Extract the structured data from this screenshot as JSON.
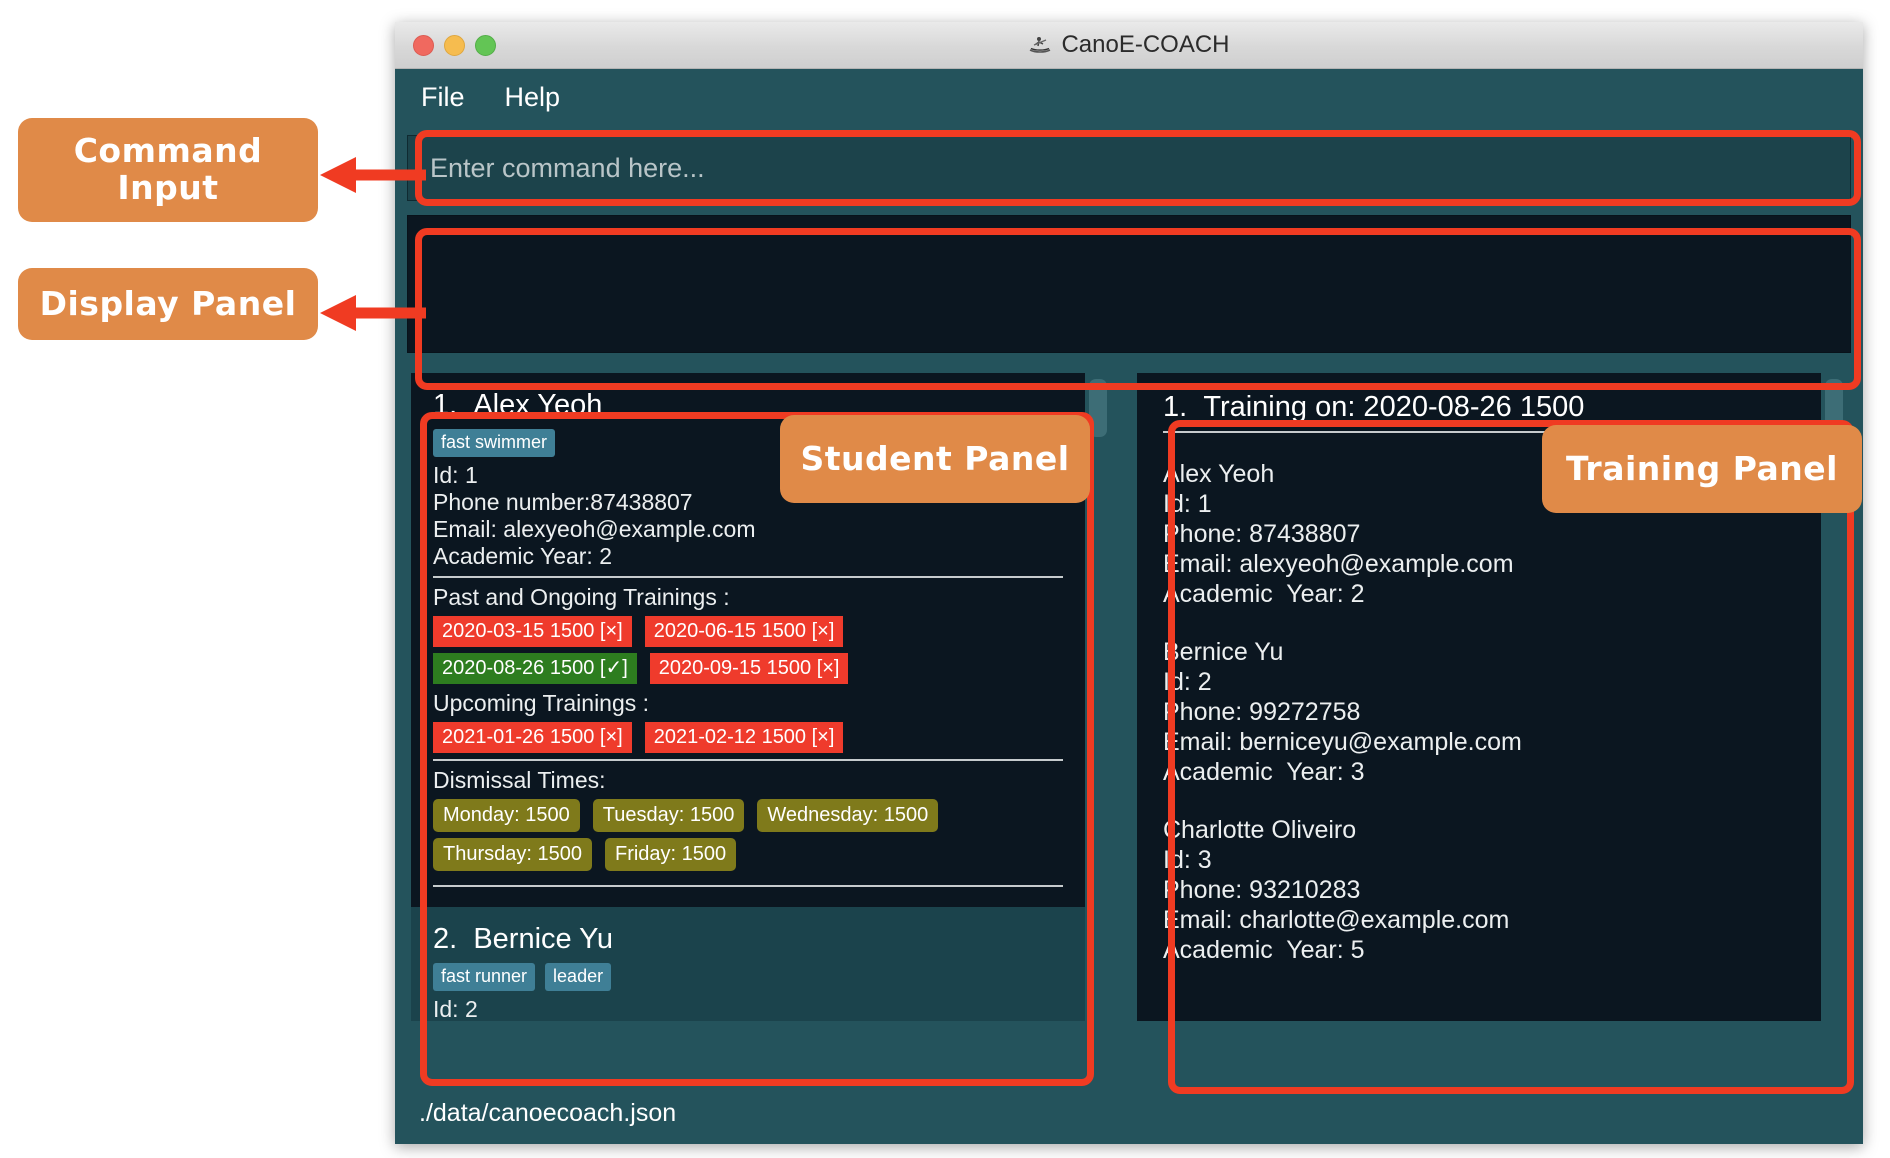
{
  "window": {
    "title": "CanoE-COACH",
    "icon": "canoe-icon",
    "traffic_lights": [
      "close-button",
      "minimize-button",
      "maximize-button"
    ]
  },
  "menubar": {
    "items": [
      {
        "label": "File"
      },
      {
        "label": "Help"
      }
    ]
  },
  "command_input": {
    "placeholder": "Enter command here...",
    "value": ""
  },
  "display_panel": {
    "content": ""
  },
  "student_panel": {
    "students": [
      {
        "index": "1.",
        "name": "Alex Yeoh",
        "tags": [
          "fast swimmer"
        ],
        "id": "Id: 1",
        "phone": "Phone number:87438807",
        "email": "Email: alexyeoh@example.com",
        "academic_year": "Academic Year: 2",
        "past_label": "Past and Ongoing Trainings :",
        "past_trainings": [
          {
            "text": "2020-03-15 1500 [×]",
            "status": "absent"
          },
          {
            "text": "2020-06-15 1500 [×]",
            "status": "absent"
          },
          {
            "text": "2020-08-26 1500 [✓]",
            "status": "attended"
          },
          {
            "text": "2020-09-15 1500 [×]",
            "status": "absent"
          }
        ],
        "upcoming_label": "Upcoming Trainings :",
        "upcoming_trainings": [
          {
            "text": "2021-01-26 1500 [×]",
            "status": "absent"
          },
          {
            "text": "2021-02-12 1500 [×]",
            "status": "absent"
          }
        ],
        "dismissal_label": "Dismissal Times:",
        "dismissal_times": [
          "Monday: 1500",
          "Tuesday: 1500",
          "Wednesday: 1500",
          "Thursday: 1500",
          "Friday: 1500"
        ]
      },
      {
        "index": "2.",
        "name": "Bernice Yu",
        "tags": [
          "fast runner",
          "leader"
        ],
        "id": "Id: 2"
      }
    ]
  },
  "training_panel": {
    "training": {
      "index": "1.",
      "title": "Training on: 2020-08-26 1500",
      "attendees": [
        {
          "name": "Alex Yeoh",
          "id": "Id: 1",
          "phone": "Phone: 87438807",
          "email": "Email: alexyeoh@example.com",
          "academic_year": "Academic  Year: 2"
        },
        {
          "name": "Bernice Yu",
          "id": "Id: 2",
          "phone": "Phone: 99272758",
          "email": "Email: berniceyu@example.com",
          "academic_year": "Academic  Year: 3"
        },
        {
          "name": "Charlotte Oliveiro",
          "id": "Id: 3",
          "phone": "Phone: 93210283",
          "email": "Email: charlotte@example.com",
          "academic_year": "Academic  Year: 5"
        }
      ]
    }
  },
  "statusbar": {
    "path": "./data/canoecoach.json"
  },
  "annotations": [
    {
      "id": "command",
      "label": "Command\nInput"
    },
    {
      "id": "display",
      "label": "Display Panel"
    },
    {
      "id": "student",
      "label": "Student Panel"
    },
    {
      "id": "training",
      "label": "Training Panel"
    }
  ],
  "colors": {
    "window_chrome": "#24535c",
    "panel_background": "#0b1620",
    "annotation_fill": "#e08a48",
    "highlight_stroke": "#f03b22",
    "tag": "#3f7f96",
    "badge_absent": "#ef3b2c",
    "badge_attended": "#2d7d1f",
    "badge_dismissal": "#7f7a1b"
  }
}
